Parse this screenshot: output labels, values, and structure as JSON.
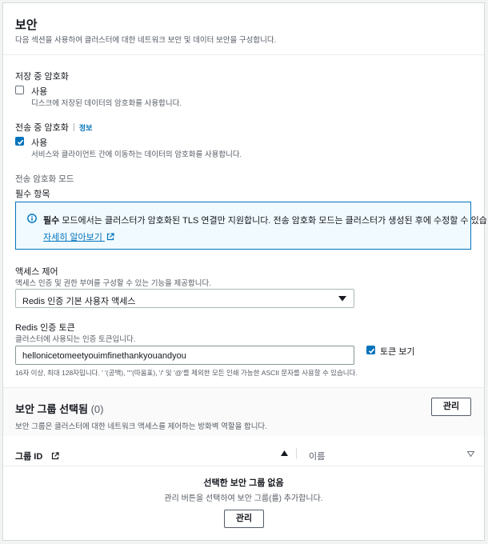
{
  "header": {
    "title": "보안",
    "description": "다음 섹션을 사용하여 클러스터에 대한 네트워크 보안 및 데이터 보안을 구성합니다."
  },
  "encryption_at_rest": {
    "title": "저장 중 암호화",
    "checkbox_label": "사용",
    "checked": false,
    "description": "디스크에 저장된 데이터의 암호화를 사용합니다."
  },
  "encryption_in_transit": {
    "title": "전송 중 암호화",
    "info_link": "정보",
    "checkbox_label": "사용",
    "checked": true,
    "description": "서비스와 클라이언트 간에 이동하는 데이터의 암호화를 사용합니다."
  },
  "transit_mode": {
    "title": "전송 암호화 모드",
    "value": "필수 항목"
  },
  "alert": {
    "bold": "필수",
    "text": " 모드에서는 클러스터가 암호화된 TLS 연결만 지원합니다. 전송 암호화 모드는 클러스터가 생성된 후에 수정할 수 있습니다.",
    "link": "자세히 알아보기"
  },
  "access_control": {
    "title": "액세스 제어",
    "description": "액세스 인증 및 권한 부여를 구성할 수 있는 기능을 제공합니다.",
    "selected": "Redis 인증 기본 사용자 액세스"
  },
  "auth_token": {
    "title": "Redis 인증 토큰",
    "description": "클러스터에 사용되는 인증 토큰입니다.",
    "value": "hellonicetomeetyouimfinethankyouandyou",
    "show_label": "토큰 보기",
    "show_checked": true,
    "hint": "16자 이상, 최대 128자입니다. ' '(공백), '\"'(따옴표), '/' 및 '@'를 제외한 모든 인쇄 가능한 ASCII 문자를 사용할 수 있습니다."
  },
  "security_groups": {
    "title": "보안 그룹 선택됨",
    "count": "(0)",
    "description": "보안 그룹은 클러스터에 대한 네트워크 액세스를 제어하는 방화벽 역할을 합니다.",
    "manage_button": "관리",
    "columns": [
      "그룹 ID",
      "이름"
    ],
    "empty_title": "선택한 보안 그룹 없음",
    "empty_desc": "관리 버튼을 선택하여 보안 그룹(를) 추가합니다.",
    "empty_button": "관리"
  },
  "colors": {
    "accent": "#0073bb",
    "text": "#16191f",
    "muted": "#545b64"
  }
}
